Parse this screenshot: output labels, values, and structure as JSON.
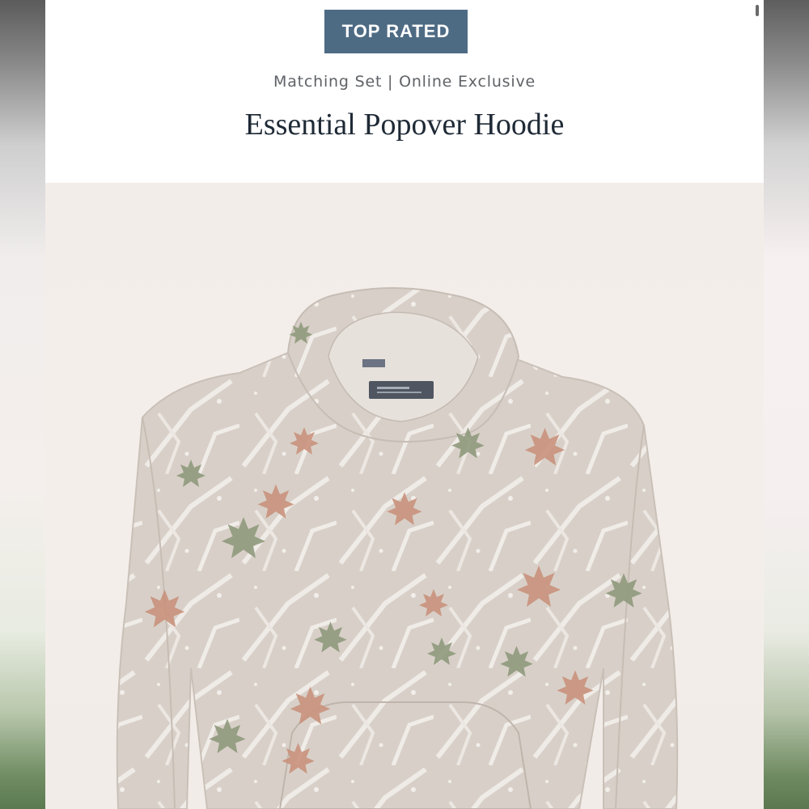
{
  "badge": {
    "label": "TOP RATED"
  },
  "product": {
    "subtitle": "Matching Set | Online Exclusive",
    "title": "Essential Popover Hoodie"
  },
  "photo": {
    "subject": "hoodie-image",
    "colors": {
      "background": "#f3ede9",
      "fabric": "#d9d1ca",
      "branch": "#eeeae6",
      "leaf_rust": "#c9927c",
      "leaf_green": "#8f9a7c",
      "label": "#4f5661"
    }
  }
}
